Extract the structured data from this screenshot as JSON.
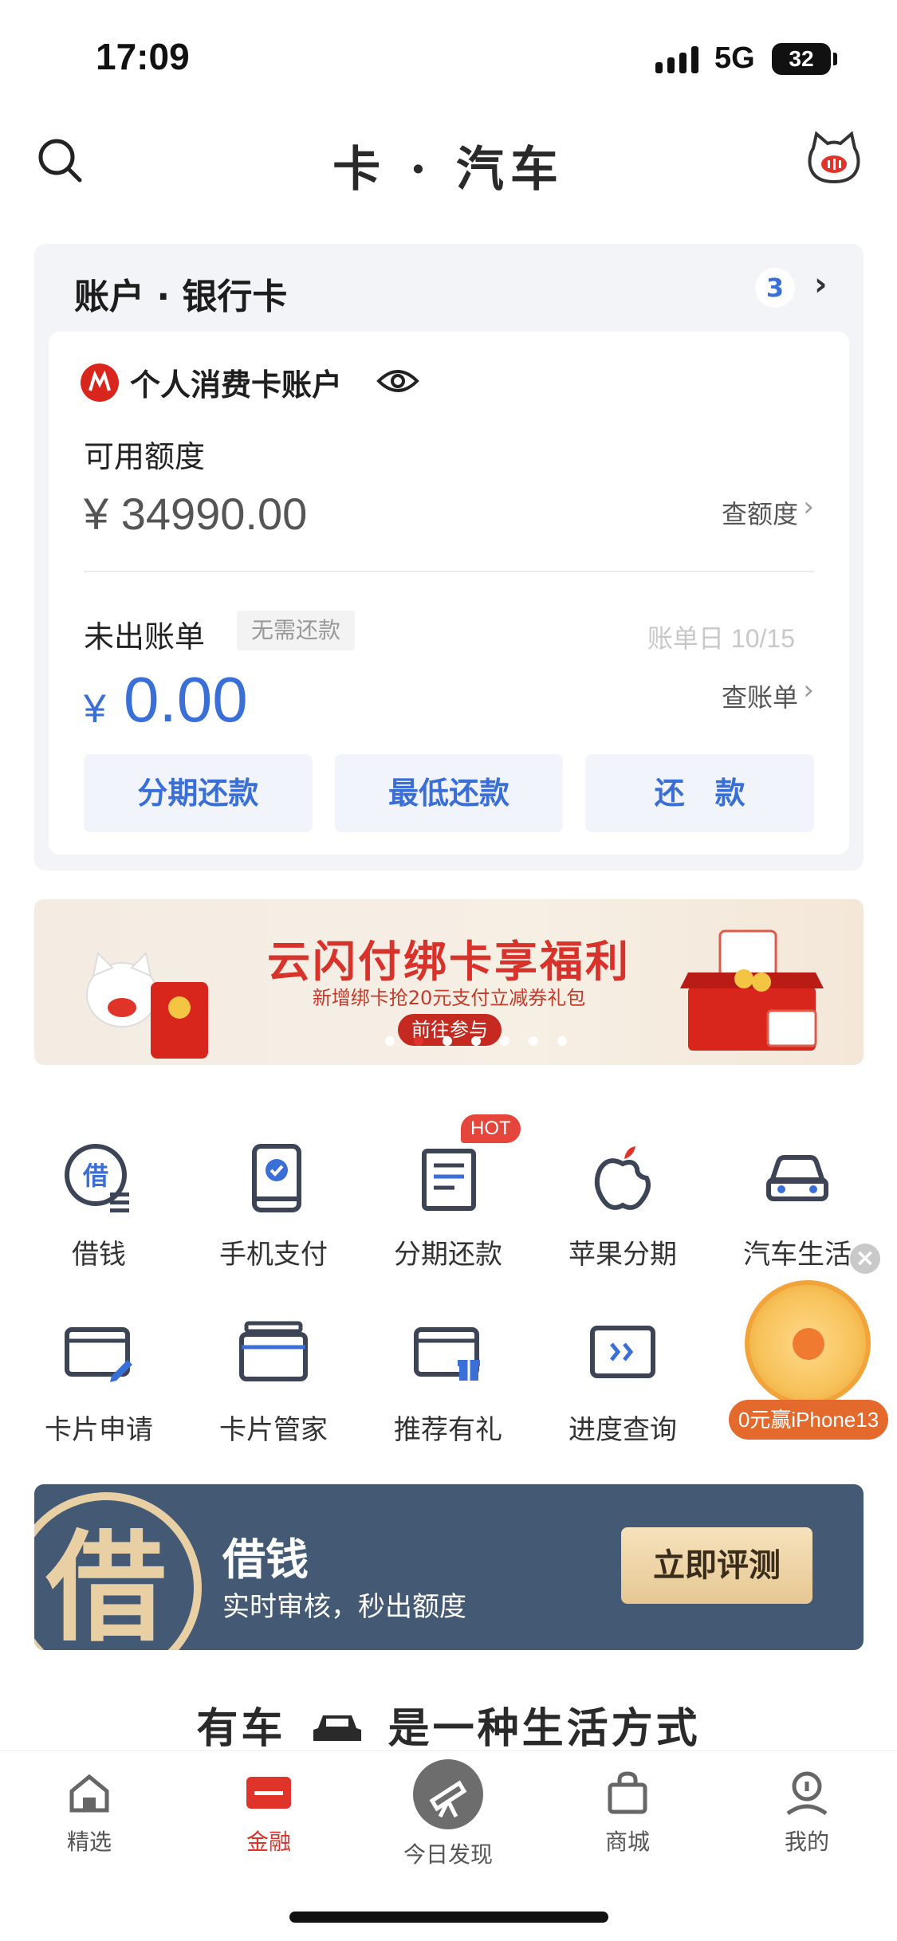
{
  "status_bar": {
    "time": "17:09",
    "network": "5G",
    "battery": "32"
  },
  "header": {
    "title": "卡 · 汽车"
  },
  "account": {
    "title": "账户 · 银行卡",
    "count": "3",
    "card_name": "个人消费卡账户",
    "available_label": "可用额度",
    "available_amount": "¥ 34990.00",
    "check_limit": "查额度",
    "bill_label": "未出账单",
    "no_repay_tag": "无需还款",
    "bill_date": "账单日 10/15",
    "bill_currency": "¥",
    "bill_amount": "0.00",
    "check_bill": "查账单",
    "buttons": [
      "分期还款",
      "最低还款",
      "还　款"
    ]
  },
  "banner": {
    "title": "云闪付绑卡享福利",
    "subtitle": "新增绑卡抢20元支付立减券礼包",
    "cta": "前往参与",
    "slide_count": 7,
    "active_slide": 1
  },
  "menu": {
    "row1": [
      {
        "label": "借钱",
        "icon": "loan-icon"
      },
      {
        "label": "手机支付",
        "icon": "phone-pay-icon"
      },
      {
        "label": "分期还款",
        "icon": "installment-icon",
        "badge": "HOT"
      },
      {
        "label": "苹果分期",
        "icon": "apple-icon"
      },
      {
        "label": "汽车生活",
        "icon": "car-icon"
      }
    ],
    "row2": [
      {
        "label": "卡片申请",
        "icon": "card-apply-icon"
      },
      {
        "label": "卡片管家",
        "icon": "card-manager-icon"
      },
      {
        "label": "推荐有礼",
        "icon": "gift-card-icon"
      },
      {
        "label": "进度查询",
        "icon": "progress-icon"
      }
    ]
  },
  "floating": {
    "label": "0元赢iPhone13",
    "close": "×"
  },
  "loan_banner": {
    "seal_char": "借",
    "title": "借钱",
    "subtitle": "实时审核，秒出额度",
    "cta": "立即评测"
  },
  "slogan": {
    "before": "有车",
    "after": "是一种生活方式"
  },
  "bottom_nav": [
    {
      "label": "精选",
      "icon": "home-icon",
      "active": false
    },
    {
      "label": "金融",
      "icon": "finance-card-icon",
      "active": true
    },
    {
      "label": "今日发现",
      "icon": "telescope-icon",
      "active": false
    },
    {
      "label": "商城",
      "icon": "bag-icon",
      "active": false
    },
    {
      "label": "我的",
      "icon": "profile-icon",
      "active": false
    }
  ],
  "colors": {
    "accent_blue": "#3b6fd8",
    "brand_red": "#e0332a",
    "loan_banner_bg": "#445a74"
  }
}
